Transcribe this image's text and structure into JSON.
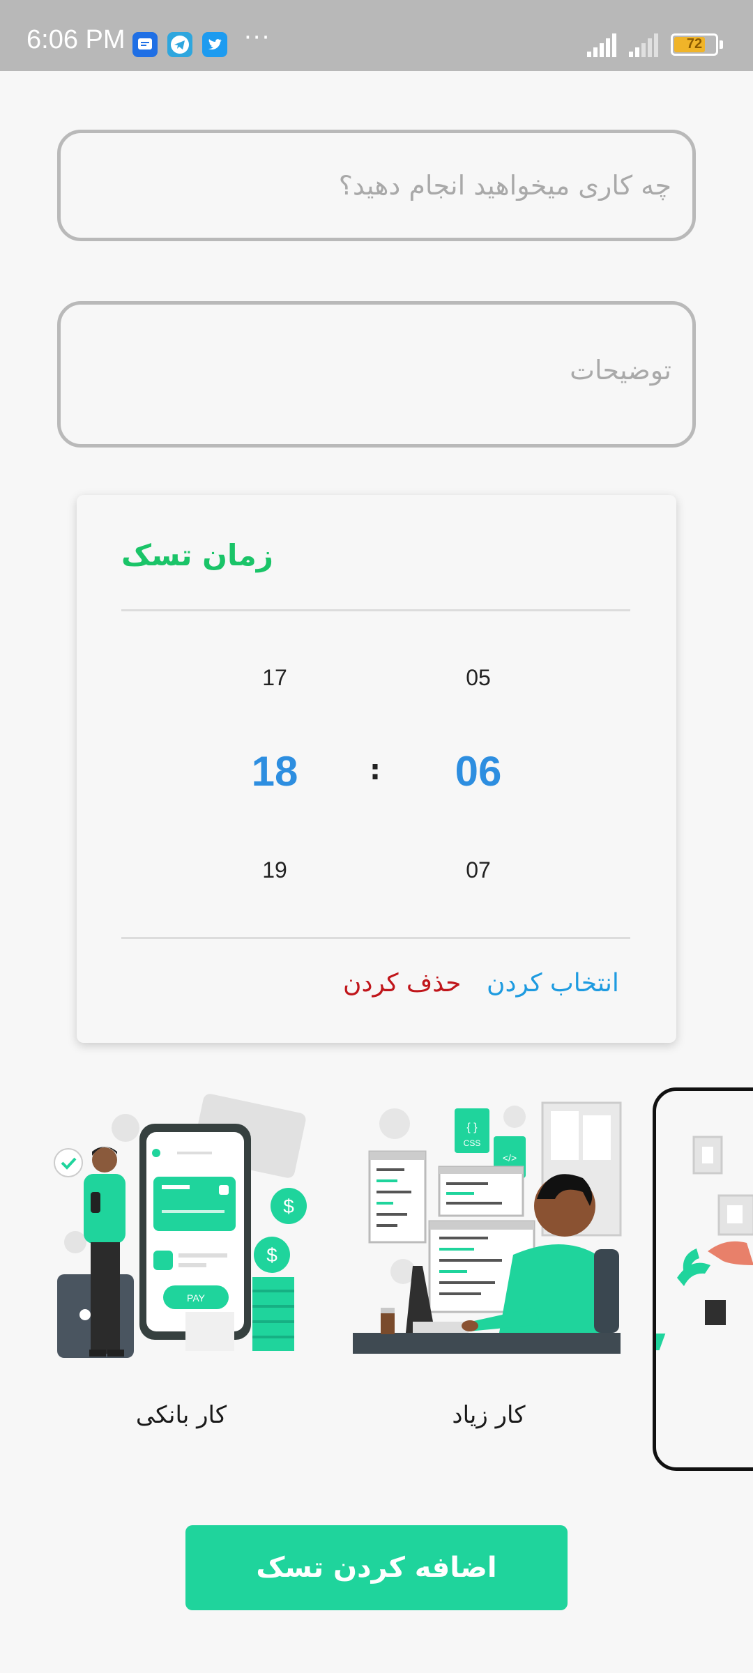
{
  "status_bar": {
    "time": "6:06 PM",
    "dots": "···",
    "battery": "72",
    "app_icons": [
      "messages-icon",
      "telegram-icon",
      "twitter-icon"
    ]
  },
  "form": {
    "title_placeholder": "چه کاری میخواهید انجام دهید؟",
    "description_placeholder": "توضیحات"
  },
  "time_picker": {
    "title": "زمان تسک",
    "hours": {
      "prev": "17",
      "current": "18",
      "next": "19"
    },
    "minutes": {
      "prev": "05",
      "current": "06",
      "next": "07"
    },
    "separator": ":",
    "select_label": "انتخاب کردن",
    "delete_label": "حذف کردن"
  },
  "categories": [
    {
      "label": "کار بانکی",
      "illustration": "banking-illustration"
    },
    {
      "label": "کار زیاد",
      "illustration": "developer-illustration"
    },
    {
      "label": "",
      "illustration": "plants-illustration"
    }
  ],
  "add_button_label": "اضافه کردن تسک",
  "colors": {
    "accent": "#1fd49c",
    "title_green": "#1ac468",
    "time_blue": "#2d8ee0",
    "select_blue": "#1e9be0",
    "delete_red": "#c0161b"
  }
}
